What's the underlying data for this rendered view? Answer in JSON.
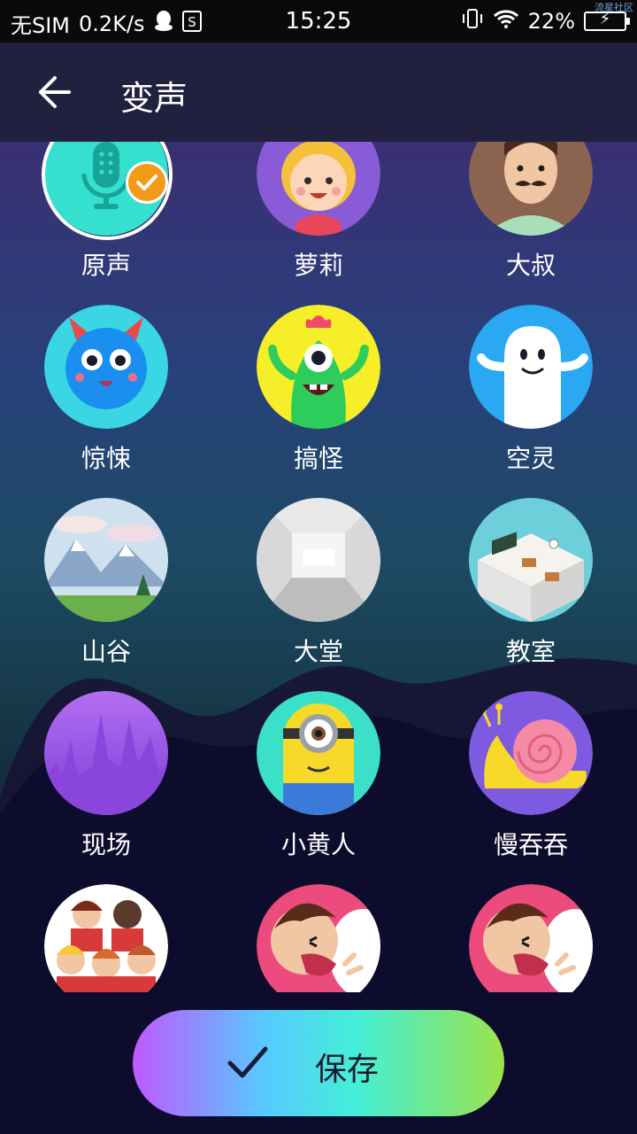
{
  "status_bar": {
    "sim": "无SIM",
    "speed": "0.2K/s",
    "time": "15:25",
    "battery": "22%",
    "corner_text": "流星社区"
  },
  "header": {
    "title": "变声"
  },
  "voices": [
    {
      "label": "原声",
      "selected": true,
      "icon": "microphone-icon",
      "color": "#35e0cf"
    },
    {
      "label": "萝莉",
      "icon": "girl-icon",
      "color": "#8a5bd6"
    },
    {
      "label": "大叔",
      "icon": "uncle-icon",
      "color": "#8b6450"
    },
    {
      "label": "惊悚",
      "icon": "blue-monster-icon",
      "color": "#3ad6e4"
    },
    {
      "label": "搞怪",
      "icon": "green-monster-icon",
      "color": "#f7ee2a"
    },
    {
      "label": "空灵",
      "icon": "ghost-icon",
      "color": "#2aa8f2"
    },
    {
      "label": "山谷",
      "icon": "mountain-icon",
      "color": "#cfe0ee"
    },
    {
      "label": "大堂",
      "icon": "hall-icon",
      "color": "#d9d9d9"
    },
    {
      "label": "教室",
      "icon": "classroom-icon",
      "color": "#6ccfd9"
    },
    {
      "label": "现场",
      "icon": "concert-icon",
      "color": "#9f5fe8"
    },
    {
      "label": "小黄人",
      "icon": "minion-icon",
      "color": "#3ae0c8"
    },
    {
      "label": "慢吞吞",
      "icon": "snail-icon",
      "color": "#7e5ae0"
    },
    {
      "label": "",
      "icon": "choir-icon",
      "color": "#ffffff"
    },
    {
      "label": "",
      "icon": "shouting-man-icon",
      "color": "#ec4b7d"
    },
    {
      "label": "",
      "icon": "shouting-man-icon",
      "color": "#ec4b7d"
    }
  ],
  "save_button": {
    "label": "保存"
  }
}
